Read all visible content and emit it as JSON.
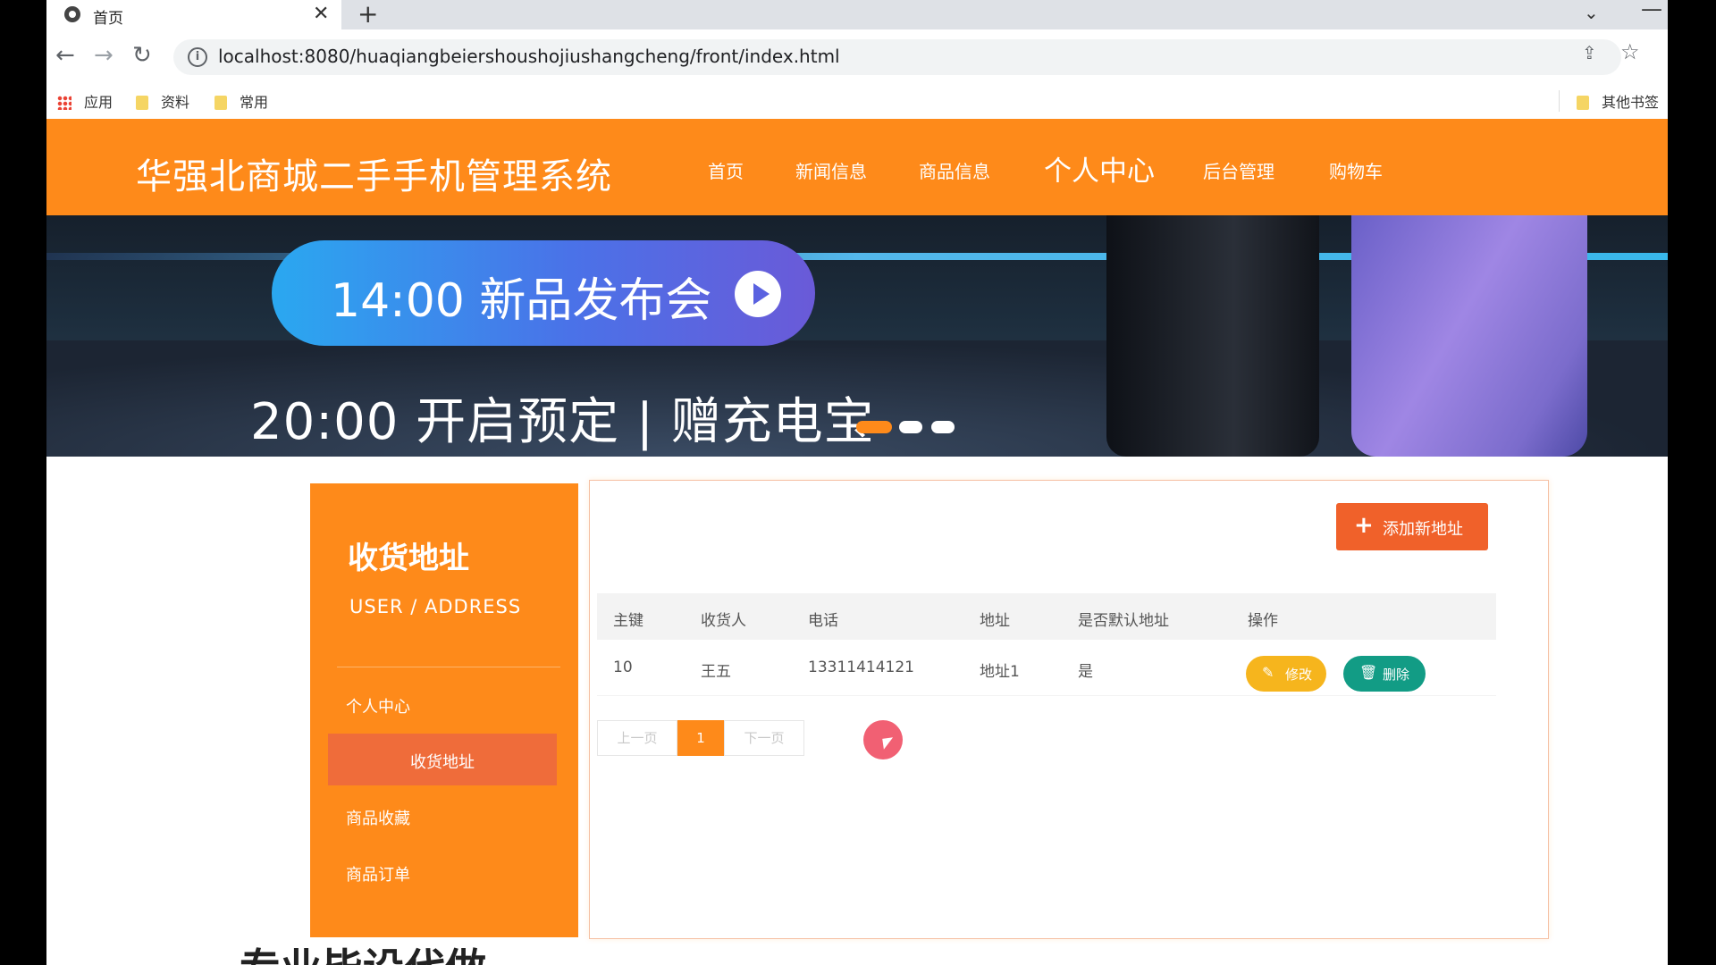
{
  "browser": {
    "tab_title": "首页",
    "tab_close": "✕",
    "new_tab": "+",
    "tab_search": "⌄",
    "window_min": "—",
    "back": "←",
    "forward": "→",
    "reload": "↻",
    "info": "i",
    "url": "localhost:8080/huaqiangbeiershoushojiushangcheng/front/index.html",
    "share": "⇪",
    "star": "☆",
    "bookmarks": [
      "应用",
      "资料",
      "常用"
    ],
    "other_bookmarks": "其他书签"
  },
  "site": {
    "title": "华强北商城二手手机管理系统",
    "nav": [
      "首页",
      "新闻信息",
      "商品信息",
      "个人中心",
      "后台管理",
      "购物车"
    ]
  },
  "banner": {
    "pill_text": "14:00 新品发布会",
    "subtitle": "20:00 开启预定 | 赠充电宝",
    "slides": 3,
    "active_slide": 1
  },
  "sidebar": {
    "title": "收货地址",
    "subtitle": "USER / ADDRESS",
    "items": [
      "个人中心",
      "收货地址",
      "商品收藏",
      "商品订单"
    ],
    "active": "收货地址"
  },
  "panel": {
    "add_button": "添加新地址",
    "columns": [
      "主键",
      "收货人",
      "电话",
      "地址",
      "是否默认地址",
      "操作"
    ],
    "rows": [
      {
        "id": "10",
        "name": "王五",
        "phone": "13311414121",
        "address": "地址1",
        "is_default": "是"
      }
    ],
    "edit_label": "修改",
    "delete_label": "删除",
    "pager": {
      "prev": "上一页",
      "current": "1",
      "next": "下一页"
    }
  },
  "overlay_text": "专业毕设代做",
  "colors": {
    "brand_orange": "#fe8a1a",
    "add_button": "#f0612a",
    "edit": "#f6b51d",
    "delete": "#129c85"
  }
}
